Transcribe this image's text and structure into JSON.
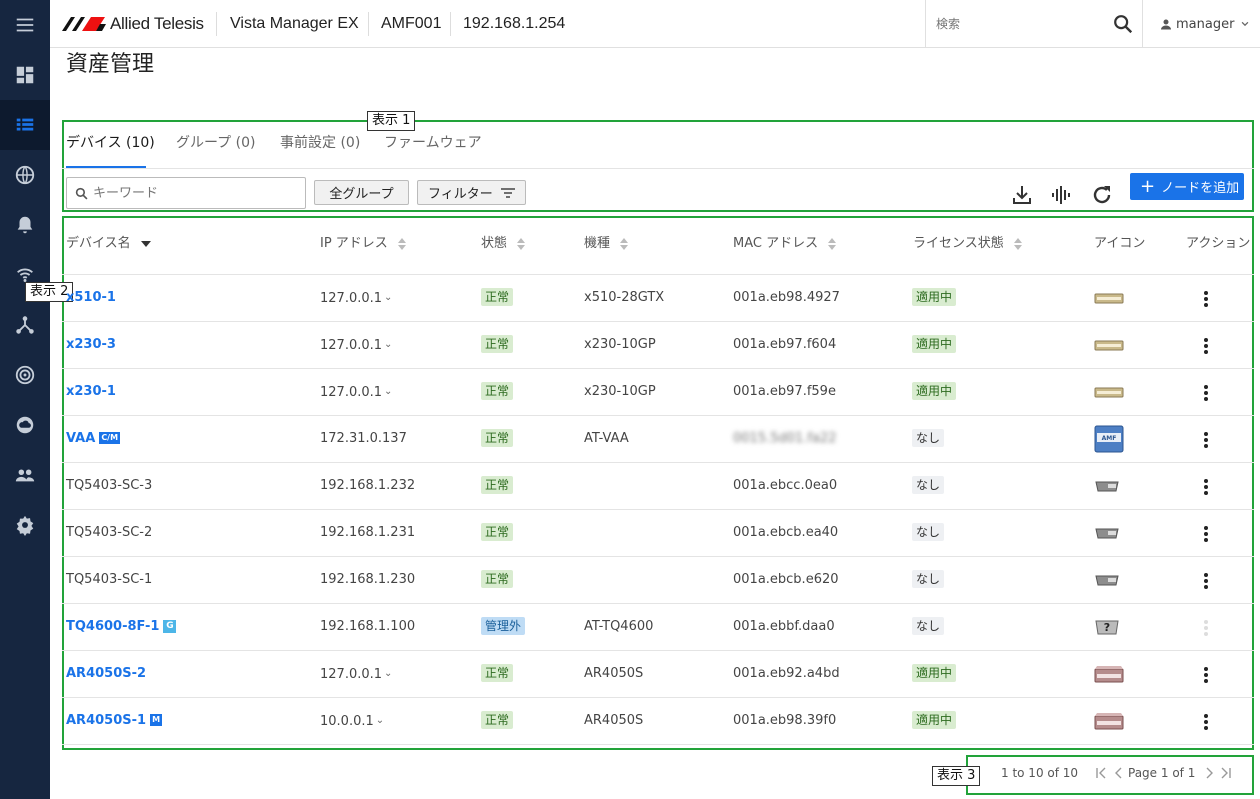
{
  "app": {
    "brand": "Allied Telesis",
    "product": "Vista Manager EX",
    "area": "AMF001",
    "ip": "192.168.1.254",
    "search_placeholder": "検索",
    "user": "manager"
  },
  "page": {
    "title": "資産管理"
  },
  "tabs": [
    {
      "label": "デバイス (10)"
    },
    {
      "label": "グループ (0)"
    },
    {
      "label": "事前設定 (0)"
    },
    {
      "label": "ファームウェア"
    }
  ],
  "toolbar": {
    "keyword_placeholder": "キーワード",
    "all_groups": "全グループ",
    "filter": "フィルター",
    "add_node": "ノードを追加"
  },
  "annotations": {
    "box1": "表示 1",
    "box2": "表示 2",
    "box3": "表示 3"
  },
  "columns": {
    "name": "デバイス名",
    "ip": "IP アドレス",
    "status": "状態",
    "model": "機種",
    "mac": "MAC アドレス",
    "license": "ライセンス状態",
    "icon": "アイコン",
    "action": "アクション"
  },
  "rows": [
    {
      "name": "x510-1",
      "ip": "127.0.0.1",
      "ip_menu": true,
      "status": "正常",
      "status_type": "ok",
      "model": "x510-28GTX",
      "mac": "001a.eb98.4927",
      "license": "適用中",
      "license_type": "ok",
      "tag": "",
      "icon": "switch-icon",
      "link": true
    },
    {
      "name": "x230-3",
      "ip": "127.0.0.1",
      "ip_menu": true,
      "status": "正常",
      "status_type": "ok",
      "model": "x230-10GP",
      "mac": "001a.eb97.f604",
      "license": "適用中",
      "license_type": "ok",
      "tag": "",
      "icon": "switch-icon",
      "link": true
    },
    {
      "name": "x230-1",
      "ip": "127.0.0.1",
      "ip_menu": true,
      "status": "正常",
      "status_type": "ok",
      "model": "x230-10GP",
      "mac": "001a.eb97.f59e",
      "license": "適用中",
      "license_type": "ok",
      "tag": "",
      "icon": "switch-icon",
      "link": true
    },
    {
      "name": "VAA",
      "ip": "172.31.0.137",
      "ip_menu": false,
      "status": "正常",
      "status_type": "ok",
      "model": "AT-VAA",
      "mac": "0015.5d01.fa22",
      "mac_blurred": true,
      "license": "なし",
      "license_type": "none",
      "tag": "C/M",
      "icon": "amf-appliance-icon",
      "link": true
    },
    {
      "name": "TQ5403-SC-3",
      "ip": "192.168.1.232",
      "ip_menu": false,
      "status": "正常",
      "status_type": "ok",
      "model": "",
      "mac": "001a.ebcc.0ea0",
      "license": "なし",
      "license_type": "none",
      "tag": "",
      "icon": "access-point-icon",
      "link": false
    },
    {
      "name": "TQ5403-SC-2",
      "ip": "192.168.1.231",
      "ip_menu": false,
      "status": "正常",
      "status_type": "ok",
      "model": "",
      "mac": "001a.ebcb.ea40",
      "license": "なし",
      "license_type": "none",
      "tag": "",
      "icon": "access-point-icon",
      "link": false
    },
    {
      "name": "TQ5403-SC-1",
      "ip": "192.168.1.230",
      "ip_menu": false,
      "status": "正常",
      "status_type": "ok",
      "model": "",
      "mac": "001a.ebcb.e620",
      "license": "なし",
      "license_type": "none",
      "tag": "",
      "icon": "access-point-icon",
      "link": false
    },
    {
      "name": "TQ4600-8F-1",
      "ip": "192.168.1.100",
      "ip_menu": false,
      "status": "管理外",
      "status_type": "unmanaged",
      "model": "AT-TQ4600",
      "mac": "001a.ebbf.daa0",
      "license": "なし",
      "license_type": "none",
      "tag": "G",
      "icon": "unknown-device-icon",
      "link": true,
      "action_disabled": true
    },
    {
      "name": "AR4050S-2",
      "ip": "127.0.0.1",
      "ip_menu": true,
      "status": "正常",
      "status_type": "ok",
      "model": "AR4050S",
      "mac": "001a.eb92.a4bd",
      "license": "適用中",
      "license_type": "ok",
      "tag": "",
      "icon": "router-icon",
      "link": true
    },
    {
      "name": "AR4050S-1",
      "ip": "10.0.0.1",
      "ip_menu": true,
      "status": "正常",
      "status_type": "ok",
      "model": "AR4050S",
      "mac": "001a.eb98.39f0",
      "license": "適用中",
      "license_type": "ok",
      "tag": "M",
      "icon": "router-icon",
      "link": true
    }
  ],
  "pagination": {
    "range": "1 to 10 of 10",
    "page": "Page 1 of 1"
  },
  "colors": {
    "sidebar": "#162640",
    "accent": "#1a73e8",
    "annotation_box": "#22a33a"
  }
}
